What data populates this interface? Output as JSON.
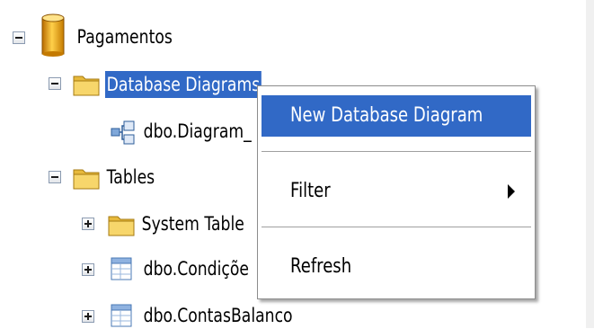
{
  "tree": {
    "root": {
      "label": "Pagamentos",
      "icon": "database-icon"
    },
    "database_diagrams": {
      "label": "Database Diagrams",
      "icon": "folder-icon"
    },
    "diagram_item": {
      "label": "dbo.Diagram_",
      "icon": "diagram-icon"
    },
    "tables": {
      "label": "Tables",
      "icon": "folder-icon"
    },
    "system_tables": {
      "label": "System Table",
      "icon": "folder-icon"
    },
    "table_condicoes": {
      "label": "dbo.Condiçõe",
      "icon": "table-icon"
    },
    "table_contas": {
      "label": "dbo.ContasBalanco",
      "icon": "table-icon"
    }
  },
  "context_menu": {
    "items": [
      {
        "label": "New Database Diagram",
        "highlighted": true
      },
      {
        "label": "Filter",
        "submenu": true
      },
      {
        "label": "Refresh"
      }
    ]
  },
  "colors": {
    "selection": "#3169c6",
    "folder": "#f2c94c",
    "database": "#e8a317"
  }
}
